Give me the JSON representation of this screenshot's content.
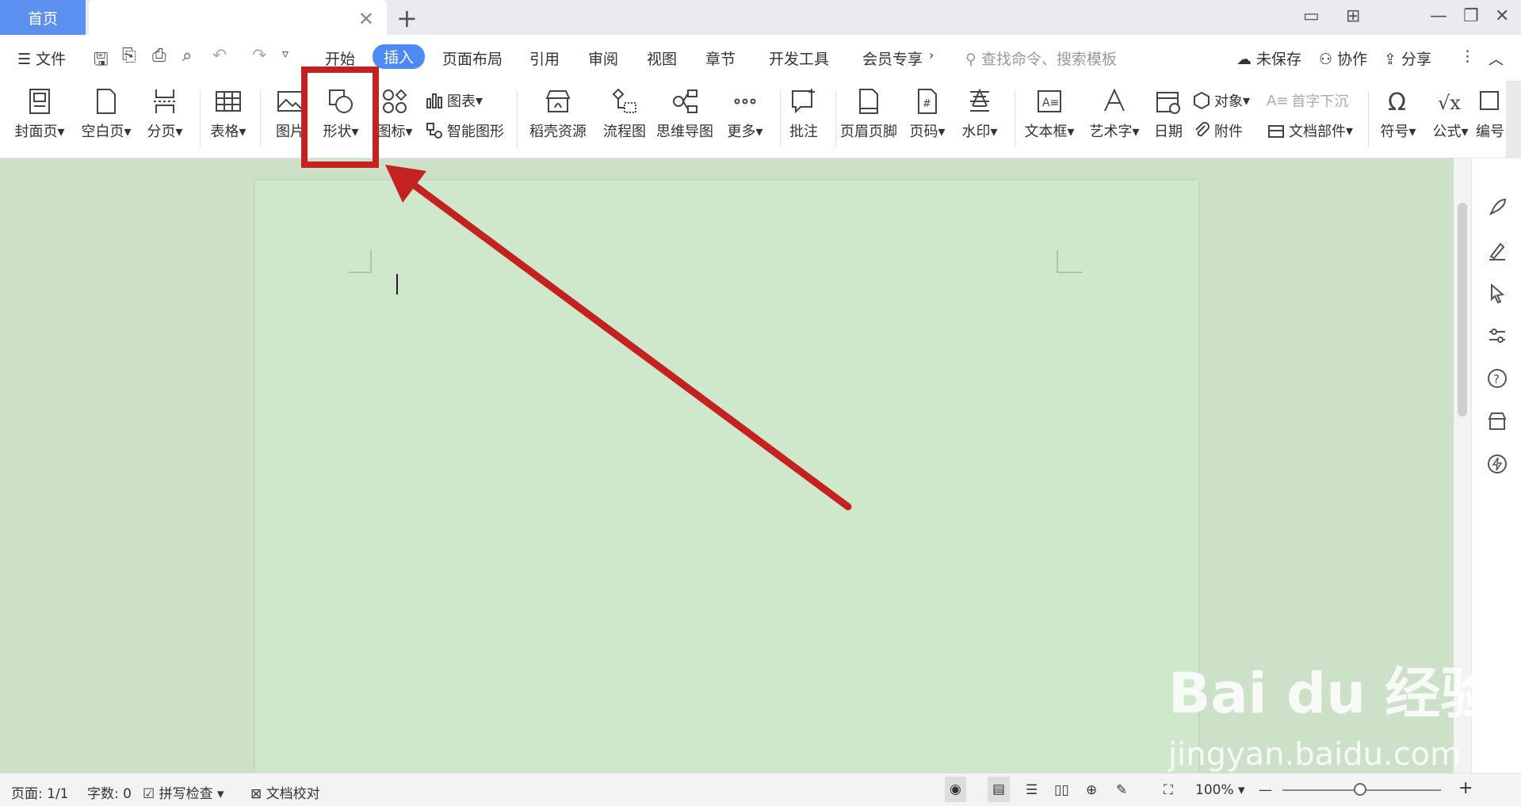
{
  "tabs": {
    "home": "首页"
  },
  "menu": {
    "file": "文件",
    "items": [
      "开始",
      "插入",
      "页面布局",
      "引用",
      "审阅",
      "视图",
      "章节",
      "开发工具",
      "会员专享"
    ],
    "active": "插入",
    "search_placeholder": "查找命令、搜索模板",
    "unsaved": "未保存",
    "collab": "协作",
    "share": "分享"
  },
  "ribbon": {
    "cover": "封面页",
    "blank": "空白页",
    "pagebreak": "分页",
    "table": "表格",
    "picture": "图片",
    "shape": "形状",
    "icon": "图标",
    "chart": "图表",
    "smartart": "智能图形",
    "resources": "稻壳资源",
    "flowchart": "流程图",
    "mindmap": "思维导图",
    "more": "更多",
    "comment": "批注",
    "headerfooter": "页眉页脚",
    "pagenum": "页码",
    "watermark": "水印",
    "textbox": "文本框",
    "wordart": "艺术字",
    "date": "日期",
    "object": "对象",
    "dropcap": "首字下沉",
    "attachment": "附件",
    "docparts": "文档部件",
    "symbol": "符号",
    "formula": "公式",
    "edit": "编号"
  },
  "status": {
    "page": "页面: 1/1",
    "words": "字数: 0",
    "spell": "拼写检查",
    "proof": "文档校对",
    "zoom": "100%"
  },
  "watermark": {
    "logo": "Bai du 经验",
    "url": "jingyan.baidu.com"
  }
}
